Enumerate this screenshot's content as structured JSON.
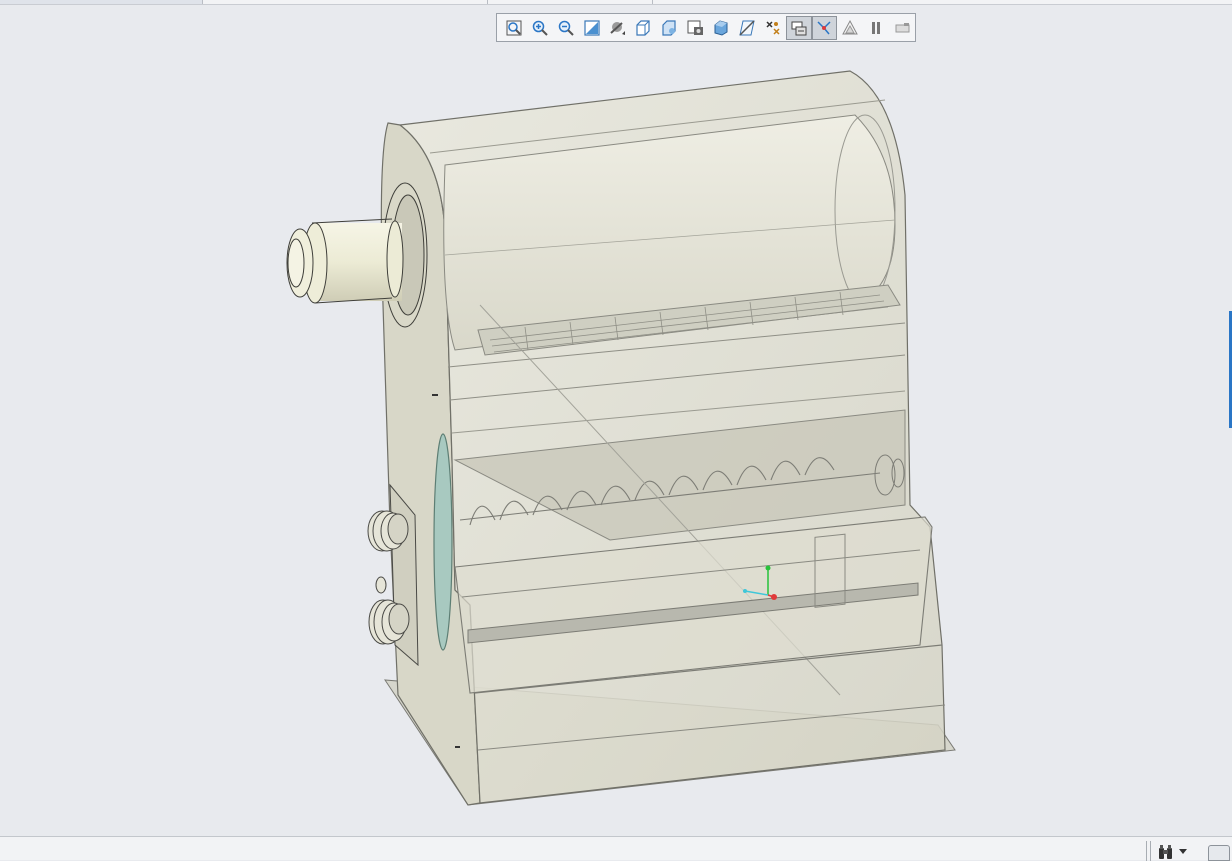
{
  "toolbar": {
    "buttons": [
      {
        "name": "zoom-fit-icon",
        "active": false
      },
      {
        "name": "zoom-in-icon",
        "active": false
      },
      {
        "name": "zoom-out-icon",
        "active": false
      },
      {
        "name": "zoom-area-icon",
        "active": false
      },
      {
        "name": "rotate-view-icon",
        "active": false
      },
      {
        "name": "view-orientation-icon",
        "active": false
      },
      {
        "name": "display-style-icon",
        "active": false
      },
      {
        "name": "saved-views-icon",
        "active": false
      },
      {
        "name": "appearance-icon",
        "active": false
      },
      {
        "name": "section-view-icon",
        "active": false
      },
      {
        "name": "datum-display-icon",
        "active": false
      },
      {
        "name": "annotation-display-icon",
        "active": true
      },
      {
        "name": "spin-center-icon",
        "active": true
      },
      {
        "name": "perspective-icon",
        "active": false
      },
      {
        "name": "pause-icon",
        "active": false
      },
      {
        "name": "repaint-icon",
        "active": false
      }
    ]
  },
  "colors": {
    "viewport_background": "#e8eaee",
    "model_fill": "#dcdbcc",
    "model_edge": "#6f6f6a",
    "axis_x": "#e03a3a",
    "axis_y": "#27c23a",
    "axis_z": "#3fc7d8",
    "selection_accent": "#2a76c6"
  }
}
